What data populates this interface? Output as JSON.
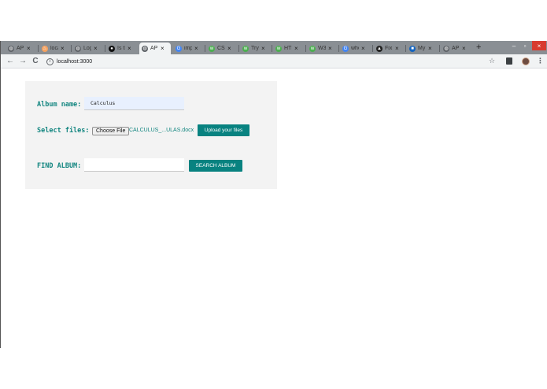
{
  "tabs": [
    {
      "title": "API",
      "fav": "globe-icon",
      "favColor": "#5f6368",
      "favGlyph": "◍"
    },
    {
      "title": "loca",
      "fav": "flame-icon",
      "favColor": "#f4a261",
      "favGlyph": "♨"
    },
    {
      "title": "Log",
      "fav": "globe-icon",
      "favColor": "#5f6368",
      "favGlyph": "◍"
    },
    {
      "title": "Is th",
      "fav": "github-icon",
      "favColor": "#111111",
      "favGlyph": "●"
    },
    {
      "title": "API",
      "fav": "globe-icon",
      "favColor": "#5f6368",
      "favGlyph": "◍"
    },
    {
      "title": "imp",
      "fav": "google-icon",
      "favColor": "#4285f4",
      "favGlyph": "G"
    },
    {
      "title": "CSS",
      "fav": "w3-icon",
      "favColor": "#4caf50",
      "favGlyph": "w"
    },
    {
      "title": "Try",
      "fav": "w3-icon",
      "favColor": "#4caf50",
      "favGlyph": "w"
    },
    {
      "title": "HTM",
      "fav": "w3-icon",
      "favColor": "#4caf50",
      "favGlyph": "w"
    },
    {
      "title": "W3",
      "fav": "w3-icon",
      "favColor": "#4caf50",
      "favGlyph": "w"
    },
    {
      "title": "whe",
      "fav": "google-icon",
      "favColor": "#4285f4",
      "favGlyph": "G"
    },
    {
      "title": "Fix",
      "fav": "car-icon",
      "favColor": "#222222",
      "favGlyph": "▲"
    },
    {
      "title": "My",
      "fav": "app-icon",
      "favColor": "#1565c0",
      "favGlyph": "■"
    },
    {
      "title": "API",
      "fav": "globe-icon",
      "favColor": "#5f6368",
      "favGlyph": "◍"
    }
  ],
  "activeTab": 4,
  "browser": {
    "url": "localhost:3000",
    "back": "←",
    "forward": "→",
    "reload": "C",
    "star": "☆",
    "menu": "⋮",
    "newTab": "+",
    "tabClose": "×",
    "minimize": "–",
    "maximize": "▫",
    "close": "×"
  },
  "form": {
    "albumNameLabel": "Album name:",
    "albumNameValue": "Calculus",
    "selectFilesLabel": "Select files:",
    "chooseFileLabel": "Choose File",
    "fileName": "CALCULUS_...ULAS.docx",
    "uploadLabel": "Upload your files",
    "findAlbumLabel": "FIND ALBUM:",
    "findAlbumValue": "",
    "searchLabel": "SEARCH ALBUM"
  },
  "colors": {
    "accent": "#088280",
    "labelText": "#138680",
    "panel": "#f3f3f3",
    "autofill": "#e8f0fe"
  }
}
